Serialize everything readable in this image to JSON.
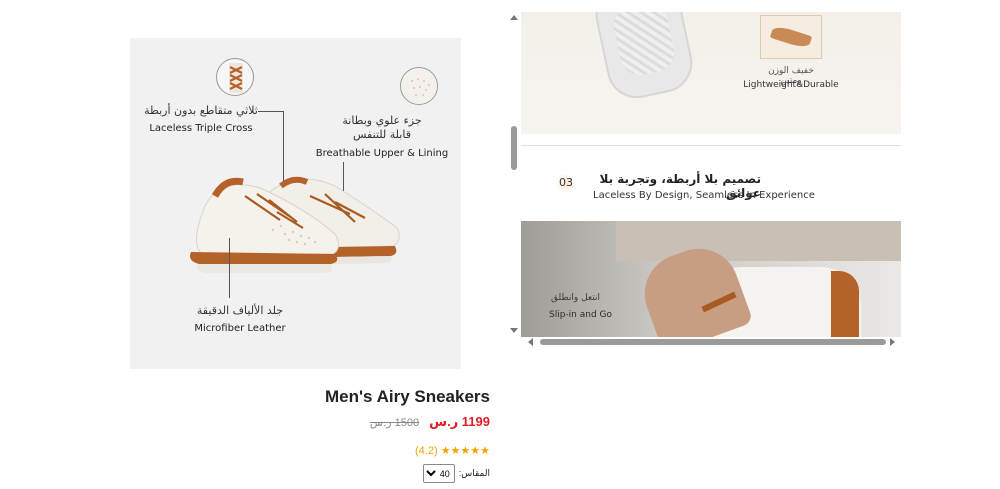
{
  "product_image": {
    "annotations": {
      "laceless": {
        "ar": "ثلاثي متقاطع بدون أربطة",
        "en": "Laceless Triple Cross"
      },
      "breathable": {
        "ar": "جزء علوي وبطانة\nقابلة للتنفس",
        "en": "Breathable Upper & Lining"
      },
      "microfiber": {
        "ar": "جلد الألياف الدقيقة",
        "en": "Microfiber Leather"
      }
    }
  },
  "scroll_panel": {
    "feature_top": {
      "ar": "خفيف الوزن ومتين",
      "en": "Lightweight&Durable"
    },
    "step": {
      "number": "03",
      "title": "تصميم بلا أربطة، وتجربة بلا عوائق",
      "subtitle": "Laceless By Design, Seamless In Experience"
    },
    "photo": {
      "ar": "انتعل وانطلق",
      "en": "Slip-in and Go"
    }
  },
  "product": {
    "name": "Men's Airy Sneakers",
    "price": "1199 ر.س",
    "old_price": "1500 ر.س",
    "stars": "★★★★★",
    "rating": "(4.2)",
    "size_label": "المقاس:",
    "size_value": "40"
  },
  "colors": {
    "accent_price": "#e21b23",
    "star": "#f0a400",
    "shoe_brown": "#b4622a"
  }
}
